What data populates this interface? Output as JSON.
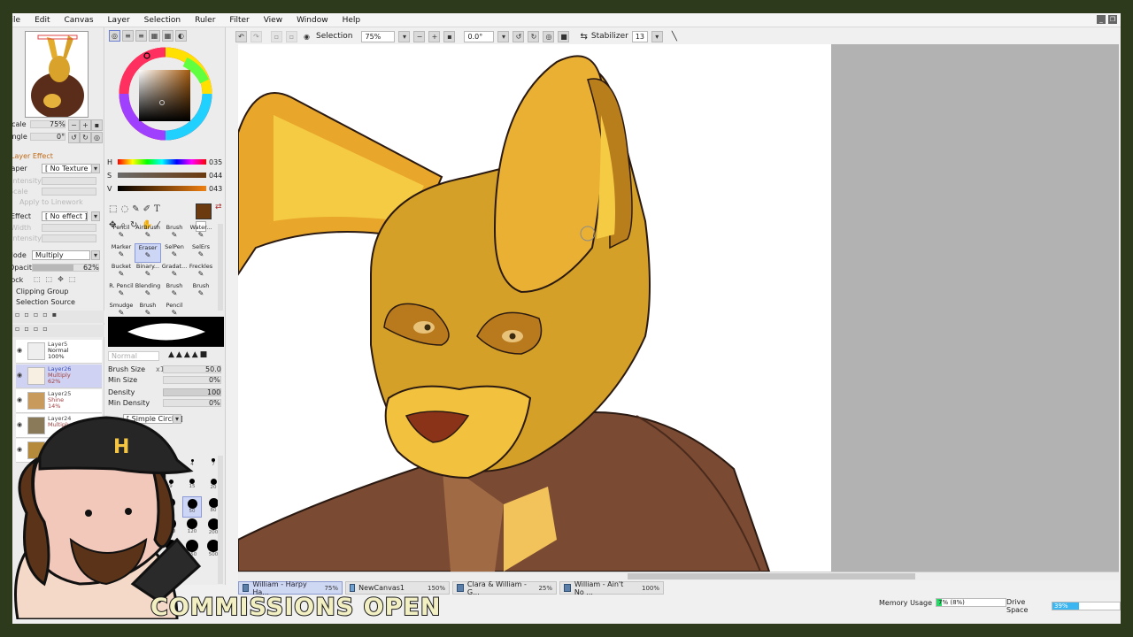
{
  "menu": [
    "File",
    "Edit",
    "Canvas",
    "Layer",
    "Selection",
    "Ruler",
    "Filter",
    "View",
    "Window",
    "Help"
  ],
  "toolbar": {
    "selection_label": "Selection",
    "zoom": "75%",
    "angle": "0.0°",
    "stabilizer_label": "Stabilizer",
    "stabilizer_value": "13"
  },
  "navigator": {
    "scale_label": "Scale",
    "scale_value": "75%",
    "angle_label": "Angle",
    "angle_value": "0°"
  },
  "layer_effect": {
    "title": "Layer Effect",
    "paper_label": "Paper",
    "paper_value": "[ No Texture ]",
    "intensity_label": "Intensity",
    "scale_label": "Scale",
    "apply_linework": "Apply to Linework",
    "effect_label": "Effect",
    "effect_value": "[ No effect ]",
    "width_label": "Width",
    "mode_label": "Mode",
    "mode_value": "Multiply",
    "opacity_label": "Opacity",
    "opacity_value": "62%",
    "lock_label": "Lock",
    "clipping_group": "Clipping Group",
    "selection_source": "Selection Source"
  },
  "layers": [
    {
      "name": "Layer5",
      "mode": "Normal",
      "opacity": "100%"
    },
    {
      "name": "Layer26",
      "mode": "Multiply",
      "opacity": "62%"
    },
    {
      "name": "Layer25",
      "mode": "Shine",
      "opacity": "14%"
    },
    {
      "name": "Layer24",
      "mode": "Multiply",
      "opacity": ""
    }
  ],
  "color": {
    "h_value": "035",
    "s_value": "044",
    "v_value": "043",
    "current": "#6b3a0e"
  },
  "tools": [
    [
      "Pencil",
      "AirBrush",
      "Brush",
      "Water..."
    ],
    [
      "Marker",
      "Eraser",
      "SelPen",
      "SelErs"
    ],
    [
      "Bucket",
      "Binary...",
      "Gradat...",
      "Freckles"
    ],
    [
      "R. Pencil",
      "Blending",
      "Brush",
      "Brush"
    ],
    [
      "Smudge",
      "Brush",
      "Pencil",
      ""
    ]
  ],
  "brush": {
    "mode": "Normal",
    "size_label": "Brush Size",
    "size_mult": "x1.0",
    "size_value": "50.0",
    "min_size_label": "Min Size",
    "min_size_value": "0%",
    "density_label": "Density",
    "density_value": "100",
    "min_density_label": "Min Density",
    "min_density_value": "0%",
    "shape_value": "[ Simple Circle ]"
  },
  "dot_sizes": [
    "3.5",
    "4",
    "7",
    "9",
    "15",
    "20",
    "40",
    "50",
    "80",
    "100",
    "120",
    "200",
    "300",
    "350",
    "500"
  ],
  "tabs": [
    {
      "name": "William - Harpy Ha...",
      "zoom": "75%",
      "active": true
    },
    {
      "name": "NewCanvas1",
      "zoom": "150%",
      "active": false
    },
    {
      "name": "Clara & William - G...",
      "zoom": "25%",
      "active": false
    },
    {
      "name": "William - Ain't No ...",
      "zoom": "100%",
      "active": false
    }
  ],
  "status": {
    "memory_label": "Memory Usage",
    "memory_value": "7% (8%)",
    "memory_fraction": 0.08,
    "drive_label": "Drive Space",
    "drive_value": "39%",
    "drive_fraction": 0.39
  },
  "overlay": {
    "banner": "COMMISSIONS OPEN",
    "hat_logo": "H"
  }
}
